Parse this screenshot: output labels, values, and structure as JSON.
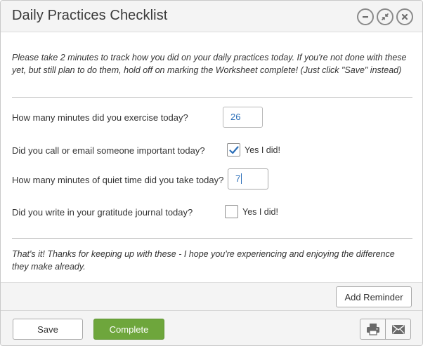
{
  "window": {
    "title": "Daily Practices Checklist",
    "controls": [
      "minimize-icon",
      "restore-icon",
      "close-icon"
    ]
  },
  "intro_text": "Please take 2 minutes to track how you did on your daily practices today. If you're not done with these yet, but still plan to do them, hold off on marking the Worksheet complete! (Just click \"Save\" instead)",
  "questions": [
    {
      "label": "How many minutes did you exercise today?",
      "type": "number",
      "value": "26"
    },
    {
      "label": "Did you call or email someone important today?",
      "type": "checkbox",
      "checked": true,
      "checkbox_label": "Yes I did!"
    },
    {
      "label": "How many minutes of quiet time did you take today?",
      "type": "number",
      "value": "7",
      "focused": true
    },
    {
      "label": "Did you write in your gratitude journal today?",
      "type": "checkbox",
      "checked": false,
      "checkbox_label": "Yes I did!"
    }
  ],
  "outro_text": "That's it! Thanks for keeping up with these - I hope you're experiencing and enjoying the difference they make already.",
  "buttons": {
    "add_reminder": "Add Reminder",
    "save": "Save",
    "complete": "Complete"
  },
  "footer_icons": [
    "print-icon",
    "email-icon"
  ],
  "colors": {
    "primary_button": "#6ea63c",
    "check_mark": "#2a6eb8",
    "input_text": "#2a6eb8"
  }
}
